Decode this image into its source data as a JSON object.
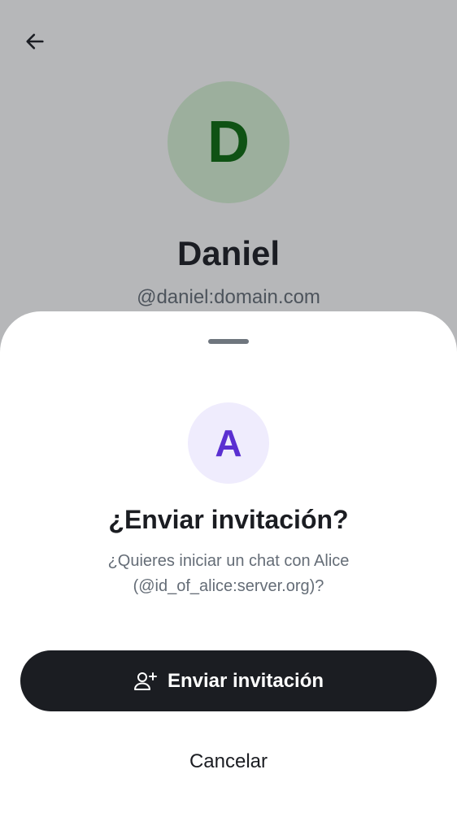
{
  "profile": {
    "back_icon": "arrow-left-icon",
    "avatar_initial": "D",
    "name": "Daniel",
    "user_id": "@daniel:domain.com"
  },
  "sheet": {
    "avatar_initial": "A",
    "title": "¿Enviar invitación?",
    "message": "¿Quieres iniciar un chat con Alice (@id_of_alice:server.org)?",
    "primary_button": {
      "label": "Enviar invitación",
      "icon": "user-add-icon"
    },
    "cancel_label": "Cancelar"
  },
  "colors": {
    "profile_avatar_bg": "#d9f4d6",
    "profile_avatar_text": "#0a6b0c",
    "invitee_avatar_bg": "#efecfd",
    "invitee_avatar_text": "#5a2fd1",
    "primary_button_bg": "#1b1d22",
    "secondary_text": "#656d77"
  }
}
